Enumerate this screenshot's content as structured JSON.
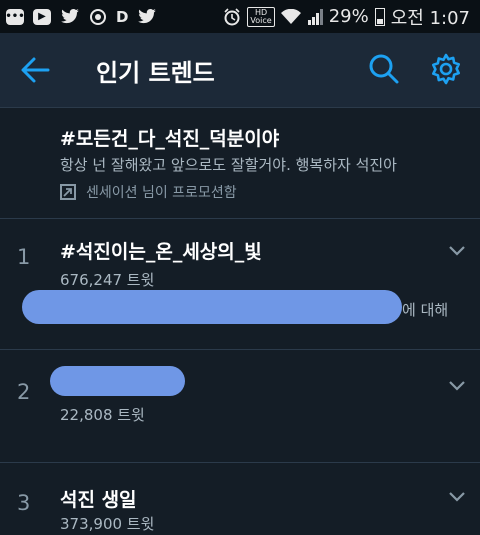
{
  "status_bar": {
    "battery": "29%",
    "time": "오전 1:07",
    "hd_label": "HD",
    "voice_label": "Voice",
    "icons": [
      "message-icon",
      "play-icon",
      "twitter-icon",
      "sync-icon",
      "d-icon",
      "twitter-icon",
      "alarm-icon",
      "hd-voice-icon",
      "wifi-icon",
      "signal-icon",
      "battery-icon"
    ]
  },
  "header": {
    "title": "인기 트렌드",
    "back_icon": "arrow-left-icon",
    "search_icon": "search-icon",
    "settings_icon": "gear-icon"
  },
  "promoted": {
    "name": "#모든건_다_석진_덕분이야",
    "description": "항상 넌 잘해왔고 앞으로도 잘할거야. 행복하자 석진아",
    "promoted_by": "센세이션 님이 프로모션함"
  },
  "trends": [
    {
      "rank": "1",
      "name": "#석진이는_온_세상의_빛",
      "count": "676,247 트윗",
      "context_tail": "에 대해"
    },
    {
      "rank": "2",
      "name": "",
      "count": "22,808 트윗"
    },
    {
      "rank": "3",
      "name": "석진 생일",
      "count": "373,900 트윗"
    }
  ],
  "colors": {
    "background": "#141d26",
    "appbar": "#1c2938",
    "accent": "#1da1f2",
    "secondary_text": "#aab8c2",
    "redaction": "#6f97e6"
  }
}
